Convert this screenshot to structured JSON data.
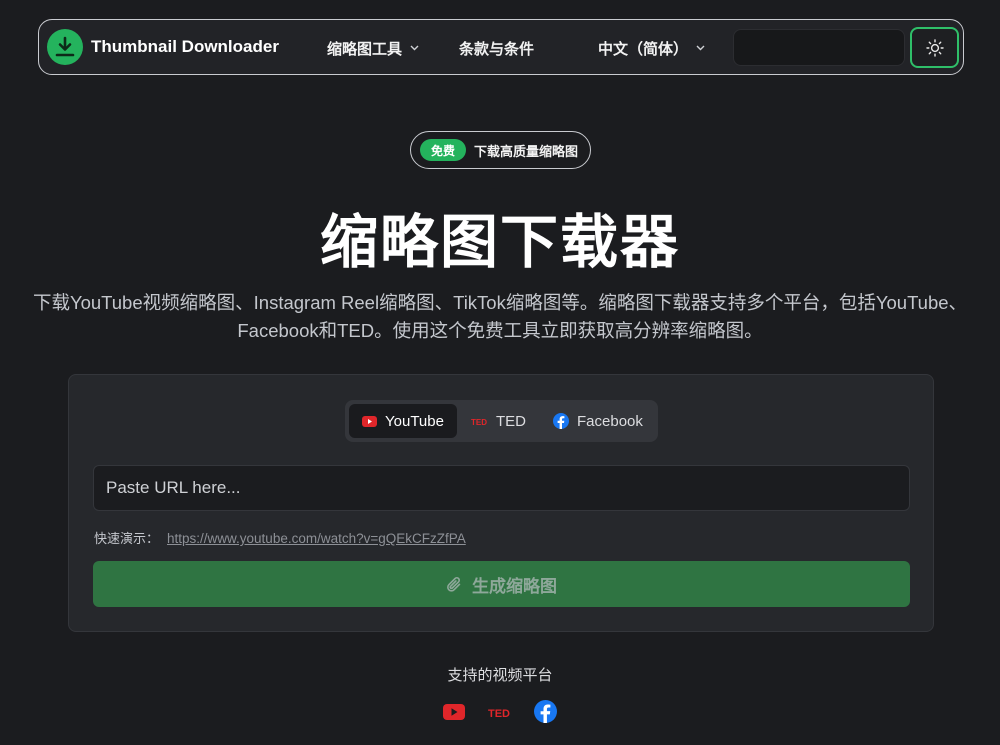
{
  "navbar": {
    "logo_text": "Thumbnail Downloader",
    "tools_label": "缩略图工具",
    "terms_label": "条款与条件",
    "language_label": "中文（简体）"
  },
  "badge": {
    "pill": "免费",
    "text": "下载高质量缩略图"
  },
  "hero": {
    "title": "缩略图下载器",
    "description_line1": "下载YouTube视频缩略图、Instagram Reel缩略图、TikTok缩略图等。缩略图下载器支持多个平台，包括YouTube、",
    "description_line2": "Facebook和TED。使用这个免费工具立即获取高分辨率缩略图。"
  },
  "downloader": {
    "tabs": [
      {
        "label": "YouTube",
        "icon": "youtube-icon",
        "active": true
      },
      {
        "label": "TED",
        "icon": "ted-icon",
        "active": false
      },
      {
        "label": "Facebook",
        "icon": "facebook-icon",
        "active": false
      }
    ],
    "url_placeholder": "Paste URL here...",
    "demo_label": "快速演示：",
    "demo_link": "https://www.youtube.com/watch?v=gQEkCFzZfPA",
    "generate_label": "生成缩略图"
  },
  "footer": {
    "supported_title": "支持的视频平台",
    "platforms": [
      "youtube-icon",
      "ted-icon",
      "facebook-icon"
    ]
  },
  "colors": {
    "accent_green": "#24b35d",
    "button_green": "#2f7442",
    "background": "#1b1c1f",
    "youtube_red": "#e0262a",
    "facebook_blue": "#1877f2"
  }
}
